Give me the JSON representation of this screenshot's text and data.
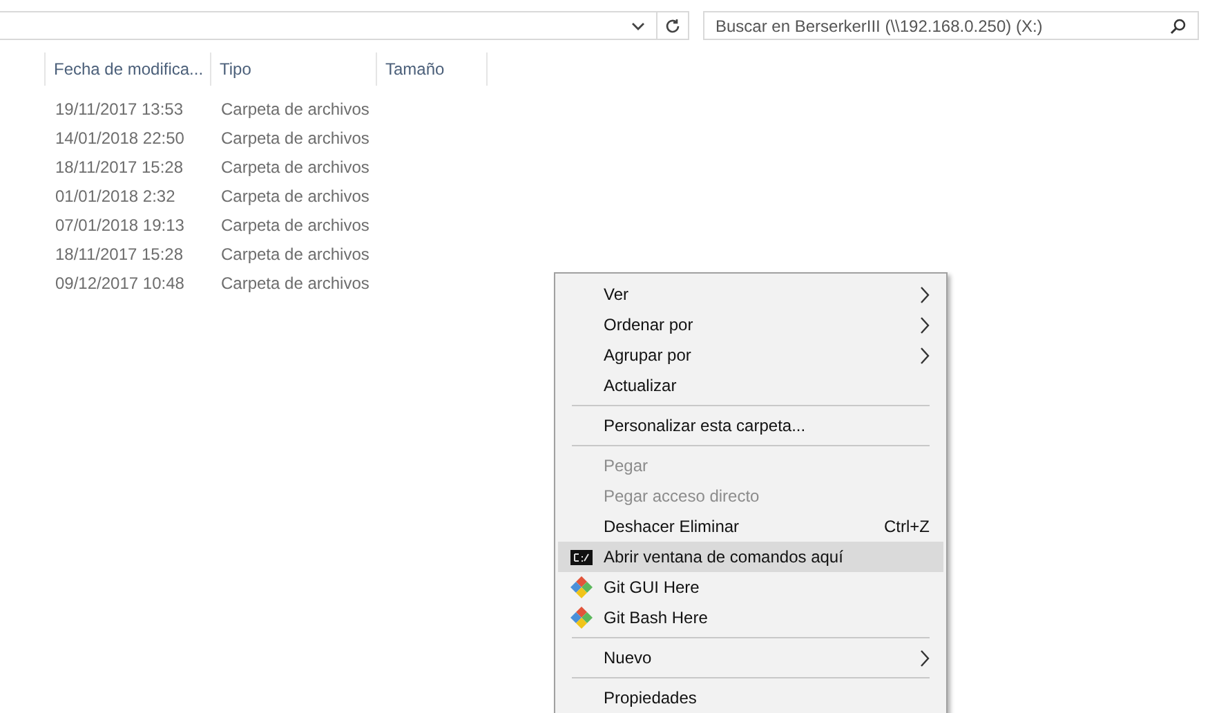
{
  "search": {
    "placeholder": "Buscar en BerserkerIII (\\\\192.168.0.250) (X:)"
  },
  "columns": [
    "Fecha de modifica...",
    "Tipo",
    "Tamaño"
  ],
  "rows": [
    {
      "date": "19/11/2017 13:53",
      "type": "Carpeta de archivos"
    },
    {
      "date": "14/01/2018 22:50",
      "type": "Carpeta de archivos"
    },
    {
      "date": "18/11/2017 15:28",
      "type": "Carpeta de archivos"
    },
    {
      "date": "01/01/2018 2:32",
      "type": "Carpeta de archivos"
    },
    {
      "date": "07/01/2018 19:13",
      "type": "Carpeta de archivos"
    },
    {
      "date": "18/11/2017 15:28",
      "type": "Carpeta de archivos"
    },
    {
      "date": "09/12/2017 10:48",
      "type": "Carpeta de archivos"
    }
  ],
  "context_menu": [
    {
      "kind": "item",
      "label": "Ver",
      "submenu": true,
      "disabled": false,
      "selected": false
    },
    {
      "kind": "item",
      "label": "Ordenar por",
      "submenu": true,
      "disabled": false,
      "selected": false
    },
    {
      "kind": "item",
      "label": "Agrupar por",
      "submenu": true,
      "disabled": false,
      "selected": false
    },
    {
      "kind": "item",
      "label": "Actualizar",
      "submenu": false,
      "disabled": false,
      "selected": false
    },
    {
      "kind": "separator"
    },
    {
      "kind": "item",
      "label": "Personalizar esta carpeta...",
      "submenu": false,
      "disabled": false,
      "selected": false
    },
    {
      "kind": "separator"
    },
    {
      "kind": "item",
      "label": "Pegar",
      "submenu": false,
      "disabled": true,
      "selected": false
    },
    {
      "kind": "item",
      "label": "Pegar acceso directo",
      "submenu": false,
      "disabled": true,
      "selected": false
    },
    {
      "kind": "item",
      "label": "Deshacer Eliminar",
      "shortcut": "Ctrl+Z",
      "submenu": false,
      "disabled": false,
      "selected": false
    },
    {
      "kind": "terminal",
      "label": "Abrir ventana de comandos aquí",
      "submenu": false,
      "disabled": false,
      "selected": true
    },
    {
      "kind": "git",
      "label": "Git GUI Here",
      "submenu": false,
      "disabled": false,
      "selected": false
    },
    {
      "kind": "git",
      "label": "Git Bash Here",
      "submenu": false,
      "disabled": false,
      "selected": false
    },
    {
      "kind": "separator"
    },
    {
      "kind": "item",
      "label": "Nuevo",
      "submenu": true,
      "disabled": false,
      "selected": false
    },
    {
      "kind": "separator"
    },
    {
      "kind": "item",
      "label": "Propiedades",
      "submenu": false,
      "disabled": false,
      "selected": false
    }
  ]
}
